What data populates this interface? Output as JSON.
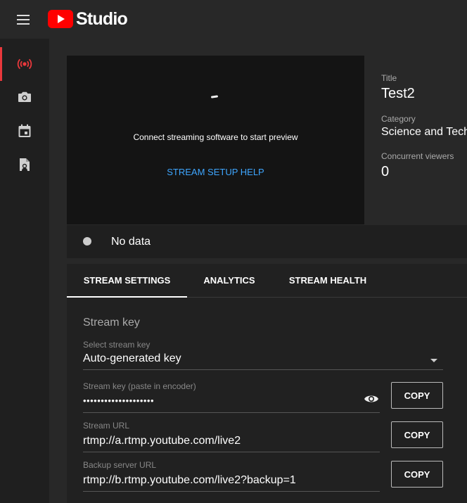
{
  "header": {
    "logo_text": "Studio"
  },
  "rail": {
    "items": [
      {
        "icon": "live-broadcast-icon",
        "active": true,
        "accent": "#e9383c"
      },
      {
        "icon": "camera-icon"
      },
      {
        "icon": "calendar-icon"
      },
      {
        "icon": "manage-icon"
      }
    ]
  },
  "preview": {
    "message": "Connect streaming software to start preview",
    "setup_link": "STREAM SETUP HELP"
  },
  "info": {
    "title_label": "Title",
    "title_value": "Test2",
    "category_label": "Category",
    "category_value": "Science and Technology",
    "viewers_label": "Concurrent viewers",
    "viewers_value": "0"
  },
  "status": {
    "text": "No data"
  },
  "tabs": [
    "STREAM SETTINGS",
    "ANALYTICS",
    "STREAM HEALTH"
  ],
  "settings": {
    "section_title": "Stream key",
    "select_label": "Select stream key",
    "select_value": "Auto-generated key",
    "key_label": "Stream key (paste in encoder)",
    "key_value": "••••••••••••••••••••",
    "url_label": "Stream URL",
    "url_value": "rtmp://a.rtmp.youtube.com/live2",
    "backup_label": "Backup server URL",
    "backup_value": "rtmp://b.rtmp.youtube.com/live2?backup=1",
    "copy_label": "COPY"
  },
  "colors": {
    "brand_red": "#ff0000",
    "link_blue": "#3ea6ff"
  }
}
